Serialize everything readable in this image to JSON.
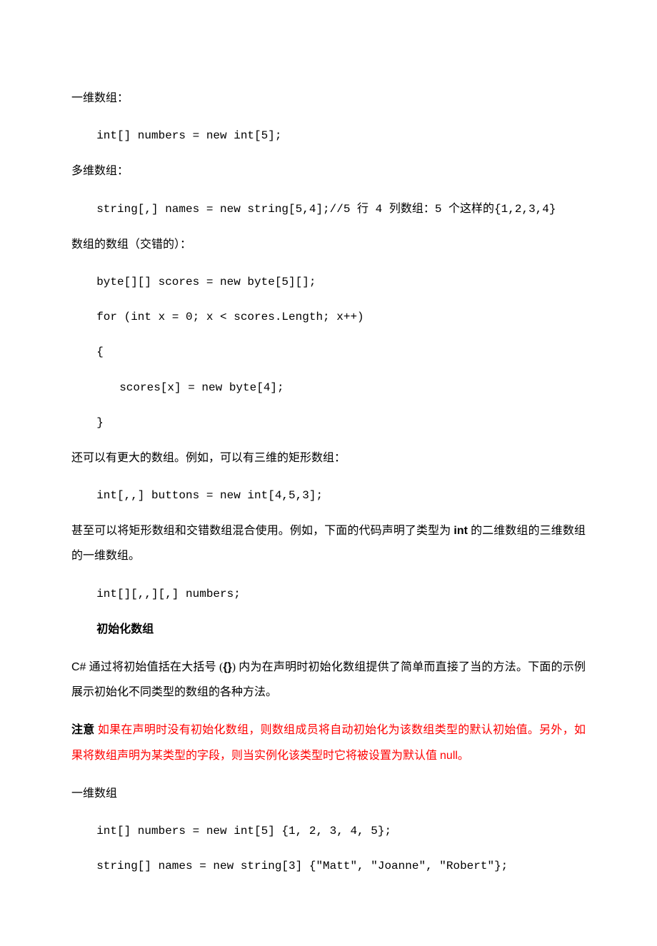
{
  "heading1": "一维数组：",
  "code1": "int[] numbers = new int[5];",
  "heading2": "多维数组：",
  "code2": "string[,] names = new string[5,4];//5 行 4 列数组：5 个这样的{1,2,3,4}",
  "heading3": "数组的数组（交错的）：",
  "code3_1": "byte[][] scores = new byte[5][];",
  "code3_2": "for (int x = 0; x < scores.Length; x++)",
  "code3_3": "{",
  "code3_4": "scores[x] = new byte[4];",
  "code3_5": "}",
  "para4": "还可以有更大的数组。例如，可以有三维的矩形数组：",
  "code4": "int[,,] buttons = new int[4,5,3];",
  "para5_pre": "甚至可以将矩形数组和交错数组混合使用。例如，下面的代码声明了类型为 ",
  "para5_bold": "int",
  "para5_post": " 的二维数组的三维数组的一维数组。",
  "code5": "int[][,,][,] numbers;",
  "heading6": "初始化数组",
  "para7_pre": "C#",
  "para7_mid": " 通过将初始值括在大括号 (",
  "para7_bold": "{}",
  "para7_post": ") 内为在声明时初始化数组提供了简单而直接了当的方法。下面的示例展示初始化不同类型的数组的各种方法。",
  "para8_label": "注意",
  "para8_text": "   如果在声明时没有初始化数组，则数组成员将自动初始化为该数组类型的默认初始值。另外，如果将数组声明为某类型的字段，则当实例化该类型时它将被设置为默认值 ",
  "para8_null": "null",
  "para8_end": "。",
  "heading9": "一维数组",
  "code9_1": "int[] numbers = new int[5] {1, 2, 3, 4, 5};",
  "code9_2": "string[] names = new string[3] {\"Matt\", \"Joanne\", \"Robert\"};"
}
